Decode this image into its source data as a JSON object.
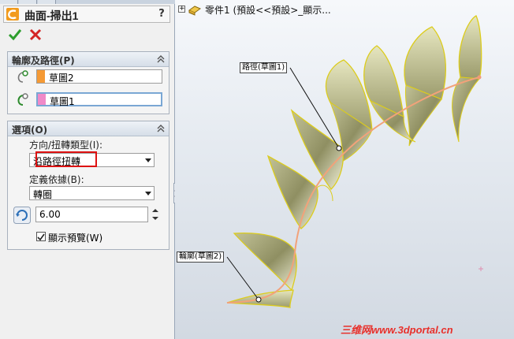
{
  "feature": {
    "title": "曲面-掃出1",
    "help_label": "?"
  },
  "profile_path": {
    "header": "輪廓及路徑(P)",
    "profile_sketch": "草圖2",
    "path_sketch": "草圖1"
  },
  "options": {
    "header": "選項(O)",
    "orientation_label": "方向/扭轉類型(I):",
    "orientation_value": "沿路徑扭轉",
    "define_by_label": "定義依據(B):",
    "define_by_value": "轉圈",
    "turns_value": "6.00",
    "show_preview_label": "顯示預覽(W)",
    "show_preview_checked": true
  },
  "tree": {
    "breadcrumb": "零件1 (預設<<預設>_顯示..."
  },
  "graphics": {
    "path_callout": "路徑(草圖1)",
    "profile_callout": "輪廓(草圖2)"
  },
  "watermark": "三维网www.3dportal.cn",
  "colors": {
    "profile_swatch": "#f59a35",
    "path_swatch": "#f08ac8",
    "sketch_line": "#e3d31d",
    "path_curve": "#f2a27a",
    "highlight_box": "#d11111"
  }
}
